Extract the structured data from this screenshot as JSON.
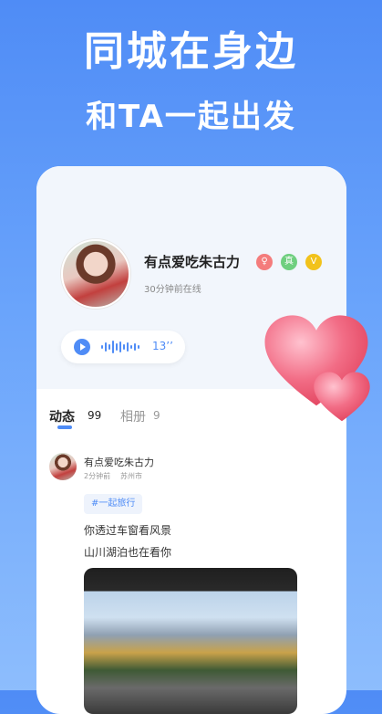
{
  "banner": {
    "title": "同城在身边",
    "subtitle": "和TA一起出发"
  },
  "profile": {
    "name": "有点爱吃朱古力",
    "badges": [
      "♀",
      "真",
      "V"
    ],
    "status": "30分钟前在线",
    "voice_duration": "13’’"
  },
  "tabs": [
    {
      "label": "动态",
      "count": "99"
    },
    {
      "label": "相册",
      "count": "9"
    }
  ],
  "post": {
    "author": "有点爱吃朱古力",
    "time": "2分钟前",
    "location": "苏州市",
    "tag": "#一起旅行",
    "lines": [
      "你透过车窗看风景",
      "山川湖泊也在看你"
    ]
  },
  "colors": {
    "accent": "#4f8cf6",
    "heart": "#f26d86"
  }
}
